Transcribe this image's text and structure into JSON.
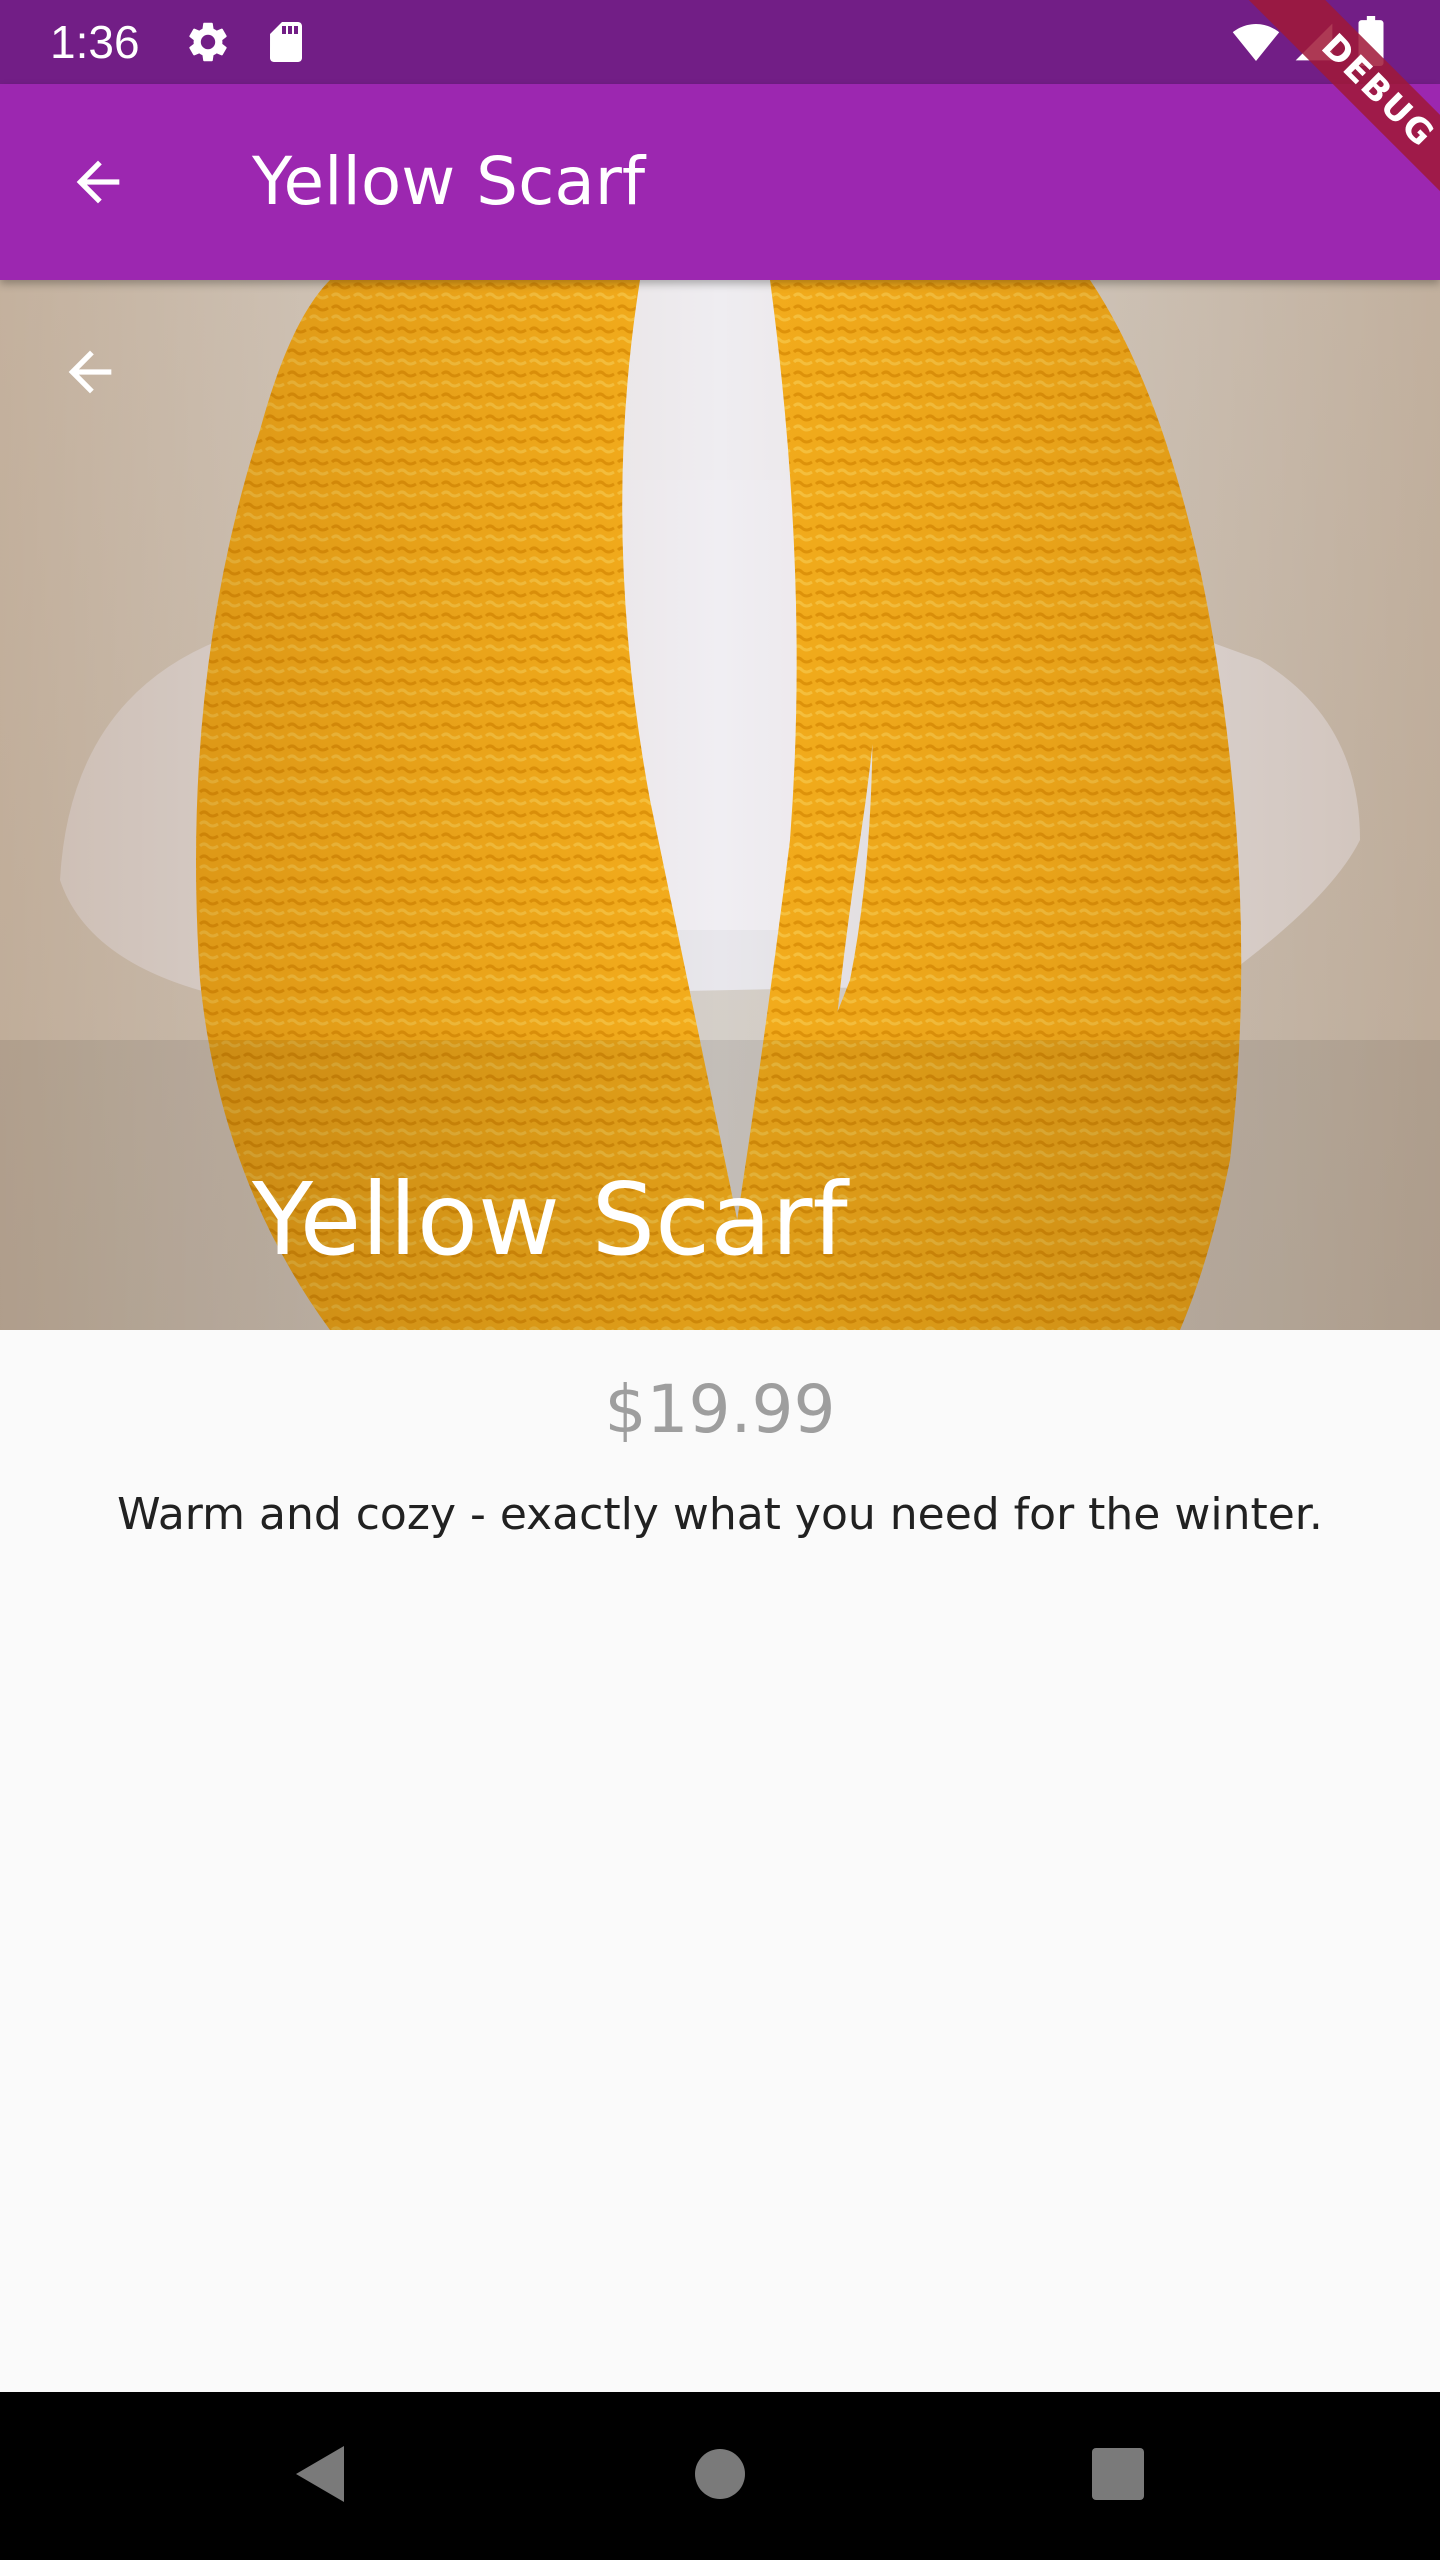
{
  "status_bar": {
    "time": "1:36",
    "icons": [
      "settings-gear-icon",
      "sd-card-icon",
      "wifi-icon",
      "signal-icon",
      "battery-icon"
    ]
  },
  "app_bar": {
    "title": "Yellow Scarf",
    "back_icon": "arrow-back-icon",
    "background_color": "#9c27b0"
  },
  "debug_banner": {
    "label": "DEBUG"
  },
  "hero": {
    "title": "Yellow Scarf",
    "back_icon": "arrow-back-icon",
    "image": "yellow knitted scarf on white mannequin"
  },
  "product": {
    "price": "$19.99",
    "description": "Warm and cozy - exactly what you need for the winter."
  },
  "nav_bar": {
    "buttons": [
      "back-triangle-icon",
      "home-circle-icon",
      "recents-square-icon"
    ]
  }
}
